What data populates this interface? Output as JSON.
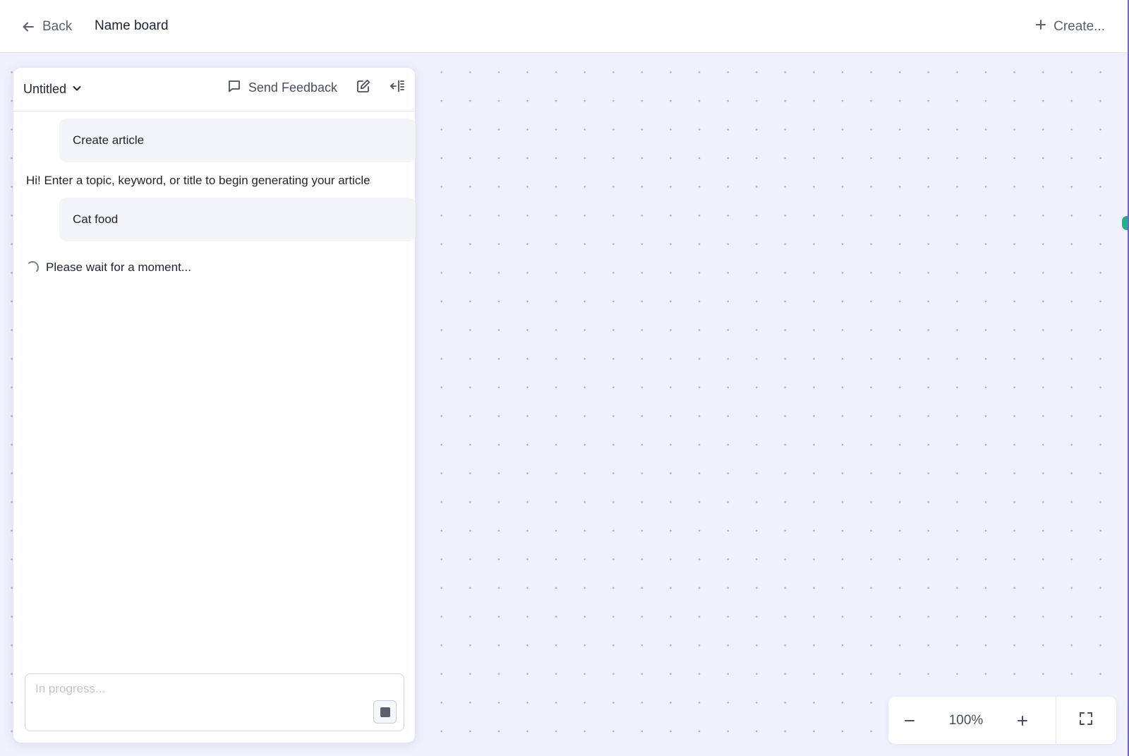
{
  "topbar": {
    "back_label": "Back",
    "board_title": "Name board",
    "create_label": "Create..."
  },
  "panel": {
    "title": "Untitled",
    "feedback_label": "Send Feedback",
    "messages": {
      "user_1": "Create article",
      "bot_1": "Hi! Enter a topic, keyword, or title to begin generating your article",
      "user_2": "Cat food",
      "status": "Please wait for a moment..."
    },
    "input": {
      "placeholder": "In progress..."
    }
  },
  "zoom": {
    "level": "100%"
  },
  "colors": {
    "canvas_bg": "#eff2fd",
    "node_handle": "#22b08a",
    "accent_edge": "#7b5fd6"
  }
}
